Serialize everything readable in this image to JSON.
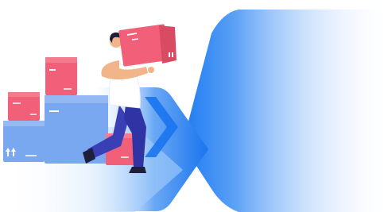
{
  "illustration": {
    "subject": "",
    "colors": {
      "background": "#ffffff",
      "brand_blue": "#1f7bf2",
      "brand_blue_light": "#d6e8fd",
      "box_pink": "#f25f78",
      "box_pink_dark": "#d94a63",
      "box_blue": "#7aa8f0",
      "box_blue_light": "#a9c6f6",
      "trousers": "#3b3fb6",
      "shirt": "#ffffff",
      "skin": "#f2b58a",
      "hair": "#1e1f3b"
    },
    "icons": [
      "up-arrows-icon",
      "fragile-icon"
    ]
  }
}
